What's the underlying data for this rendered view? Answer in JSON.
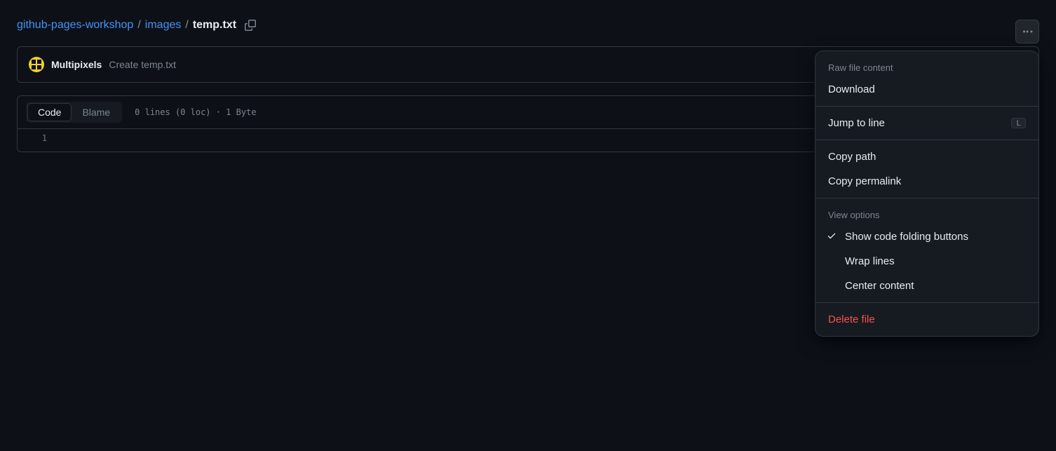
{
  "breadcrumb": {
    "repo": "github-pages-workshop",
    "folder": "images",
    "file": "temp.txt",
    "sep": "/"
  },
  "commit": {
    "author": "Multipixels",
    "message": "Create temp.txt"
  },
  "file": {
    "tabs": {
      "code": "Code",
      "blame": "Blame"
    },
    "stats": "0 lines (0 loc) · 1 Byte",
    "line_numbers": [
      "1"
    ]
  },
  "menu": {
    "section_raw": "Raw file content",
    "download": "Download",
    "jump": "Jump to line",
    "jump_kbd": "L",
    "copy_path": "Copy path",
    "copy_permalink": "Copy permalink",
    "section_view": "View options",
    "show_folding": "Show code folding buttons",
    "wrap_lines": "Wrap lines",
    "center_content": "Center content",
    "delete": "Delete file"
  }
}
